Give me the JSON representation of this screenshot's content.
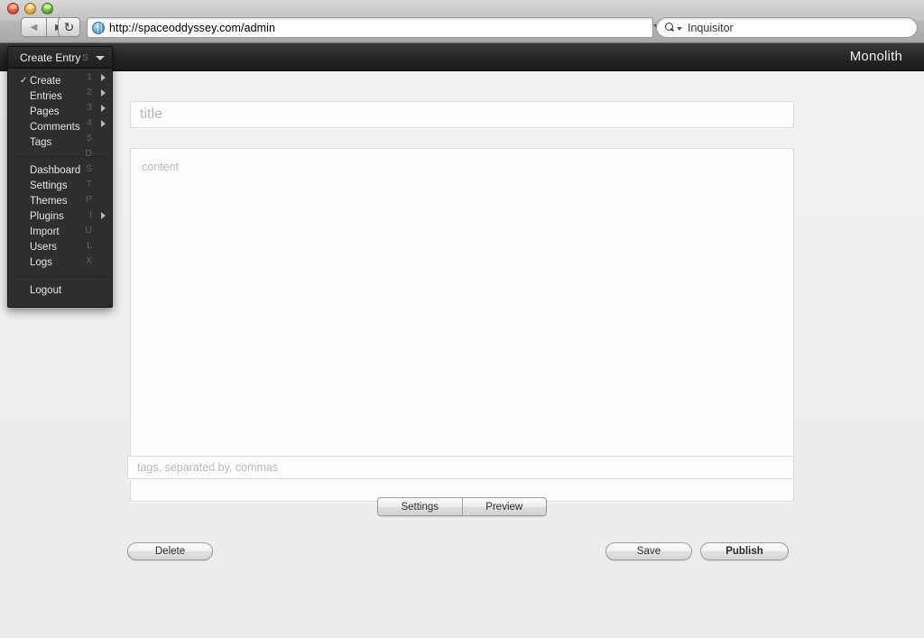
{
  "browser": {
    "back_label": "◀",
    "forward_label": "▶",
    "reload_label": "↻",
    "url": "http://spaceoddyssey.com/admin",
    "search_value": "Inquisitor"
  },
  "app": {
    "brand": "Monolith"
  },
  "menu": {
    "header": {
      "label": "Create Entry",
      "key": "S"
    },
    "group1": [
      {
        "label": "Create",
        "key": "1",
        "checked": true,
        "submenu": true
      },
      {
        "label": "Entries",
        "key": "2",
        "checked": false,
        "submenu": true
      },
      {
        "label": "Pages",
        "key": "3",
        "checked": false,
        "submenu": true
      },
      {
        "label": "Comments",
        "key": "4",
        "checked": false,
        "submenu": true
      },
      {
        "label": "Tags",
        "key": "5",
        "checked": false,
        "submenu": false
      }
    ],
    "group2": [
      {
        "label": "Dashboard",
        "key": "D",
        "submenu": false
      },
      {
        "label": "Settings",
        "key": "S",
        "submenu": true
      },
      {
        "label": "Themes",
        "key": "T",
        "submenu": false
      },
      {
        "label": "Plugins",
        "key": "P",
        "submenu": false
      },
      {
        "label": "Import",
        "key": "I",
        "submenu": false
      },
      {
        "label": "Users",
        "key": "U",
        "submenu": false
      },
      {
        "label": "Logs",
        "key": "L",
        "submenu": false
      }
    ],
    "group3": [
      {
        "label": "Logout",
        "key": "X",
        "submenu": false
      }
    ]
  },
  "editor": {
    "title_placeholder": "title",
    "content_placeholder": "content",
    "tags_placeholder": "tags, separated by, commas",
    "segmented": [
      {
        "label": "Settings"
      },
      {
        "label": "Preview"
      }
    ],
    "delete_label": "Delete",
    "save_label": "Save",
    "publish_label": "Publish"
  },
  "colors": {
    "chrome": "#c3c3c3",
    "app_header": "#262626",
    "canvas": "#eeeeee",
    "menu_bg": "#2e2e2e",
    "menu_key": "#5f5f5f",
    "placeholder": "#b8b8b8"
  }
}
